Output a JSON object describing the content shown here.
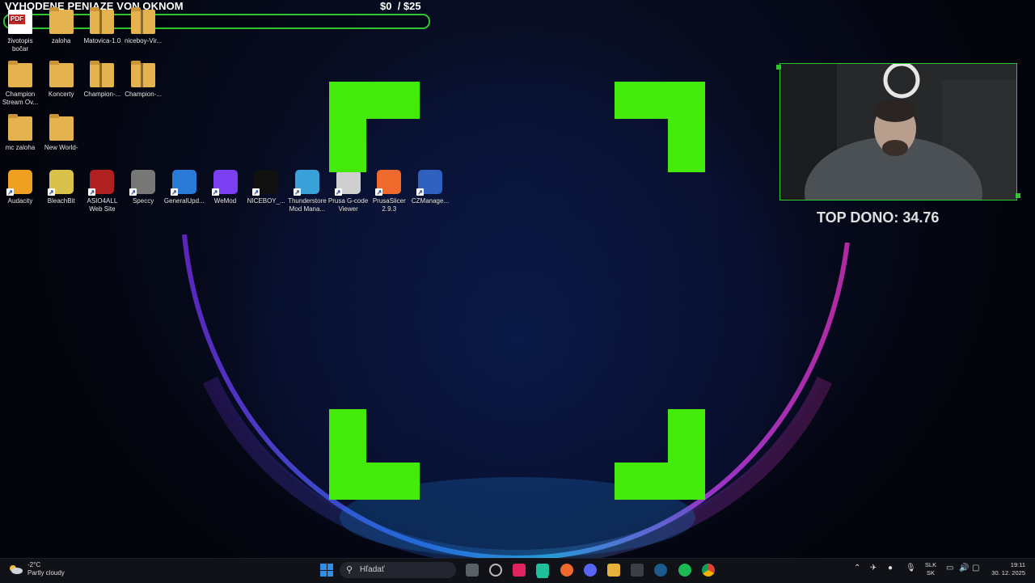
{
  "overlay": {
    "goal_title": "VYHODENE PENIAZE VON OKNOM",
    "goal_amount": "$0",
    "goal_target": "/ $25",
    "goal_progress_fraction": 0,
    "top_dono": "TOP DONO: 34.76",
    "accent_color": "#44ea0a"
  },
  "desktop": {
    "row1": [
      {
        "label": "životopis bočar",
        "icon": "pdf-icon"
      },
      {
        "label": "zaloha",
        "icon": "folder-icon"
      },
      {
        "label": "Matovica-1.0",
        "icon": "zip-folder-icon"
      },
      {
        "label": "niceboy-Vir...",
        "icon": "zip-folder-icon"
      }
    ],
    "row2": [
      {
        "label": "Champion Stream Ov...",
        "icon": "folder-icon"
      },
      {
        "label": "Koncerty",
        "icon": "folder-icon"
      },
      {
        "label": "Champion-...",
        "icon": "zip-folder-icon"
      },
      {
        "label": "Champion-...",
        "icon": "zip-folder-icon"
      }
    ],
    "row3": [
      {
        "label": "mc zaloha",
        "icon": "folder-icon"
      },
      {
        "label": "New World-",
        "icon": "folder-icon"
      }
    ],
    "row4": [
      {
        "label": "Audacity",
        "icon": "audacity-icon"
      },
      {
        "label": "BleachBit",
        "icon": "bleachbit-icon"
      },
      {
        "label": "ASIO4ALL Web Site",
        "icon": "asio4all-icon"
      },
      {
        "label": "Speccy",
        "icon": "speccy-icon"
      },
      {
        "label": "GeneralUpd...",
        "icon": "general-update-icon"
      },
      {
        "label": "WeMod",
        "icon": "wemod-icon"
      },
      {
        "label": "NICEBOY_...",
        "icon": "niceboy-icon"
      },
      {
        "label": "Thunderstore Mod Mana...",
        "icon": "thunderstore-icon"
      },
      {
        "label": "Prusa G-code Viewer",
        "icon": "prusa-gcode-icon"
      },
      {
        "label": "PrusaSlicer 2.9.3",
        "icon": "prusaslicer-icon"
      },
      {
        "label": "CZManage...",
        "icon": "czmanager-icon"
      }
    ]
  },
  "taskbar": {
    "weather_temp": "-2°C",
    "weather_desc": "Partly cloudy",
    "search_placeholder": "Hľadať",
    "lang_top": "SLK",
    "lang_bottom": "SK",
    "time": "19:11",
    "date": "30. 12. 2025"
  }
}
